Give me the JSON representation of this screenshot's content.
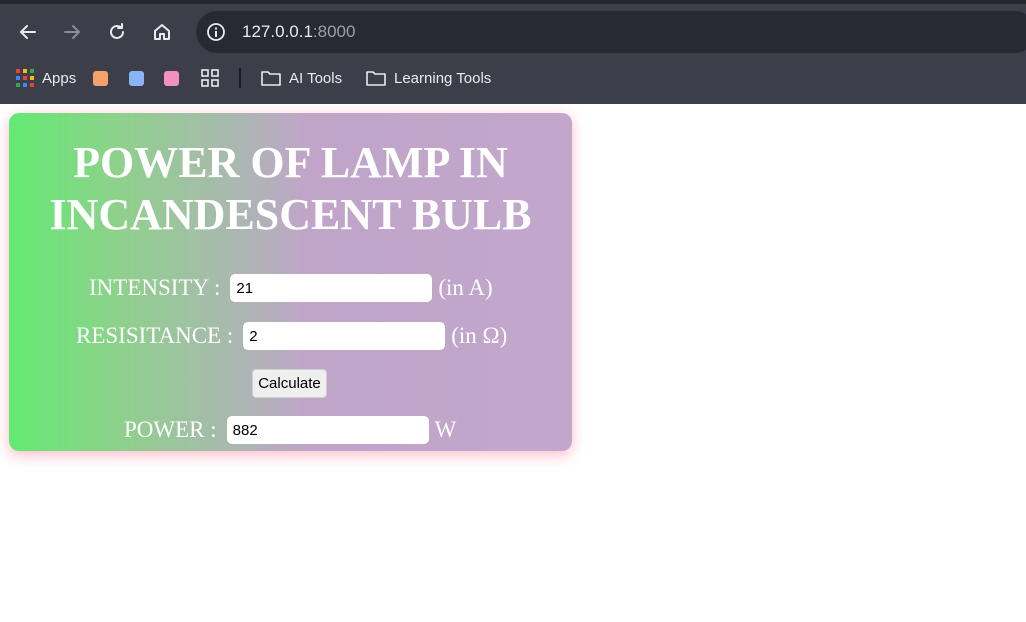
{
  "browser": {
    "url_host": "127.0.0.1",
    "url_port": ":8000",
    "bookmarks": {
      "apps": "Apps",
      "folder1": "AI Tools",
      "folder2": "Learning Tools"
    }
  },
  "page": {
    "title_line1": "POWER OF LAMP IN",
    "title_line2": "INCANDESCENT BULB",
    "intensity": {
      "label": "INTENSITY :",
      "value": "21",
      "unit": "(in A)"
    },
    "resistance": {
      "label": "RESISITANCE :",
      "value": "2",
      "unit": "(in Ω)"
    },
    "calculate_label": "Calculate",
    "power": {
      "label": "POWER :",
      "value": "882",
      "unit": "W"
    }
  }
}
